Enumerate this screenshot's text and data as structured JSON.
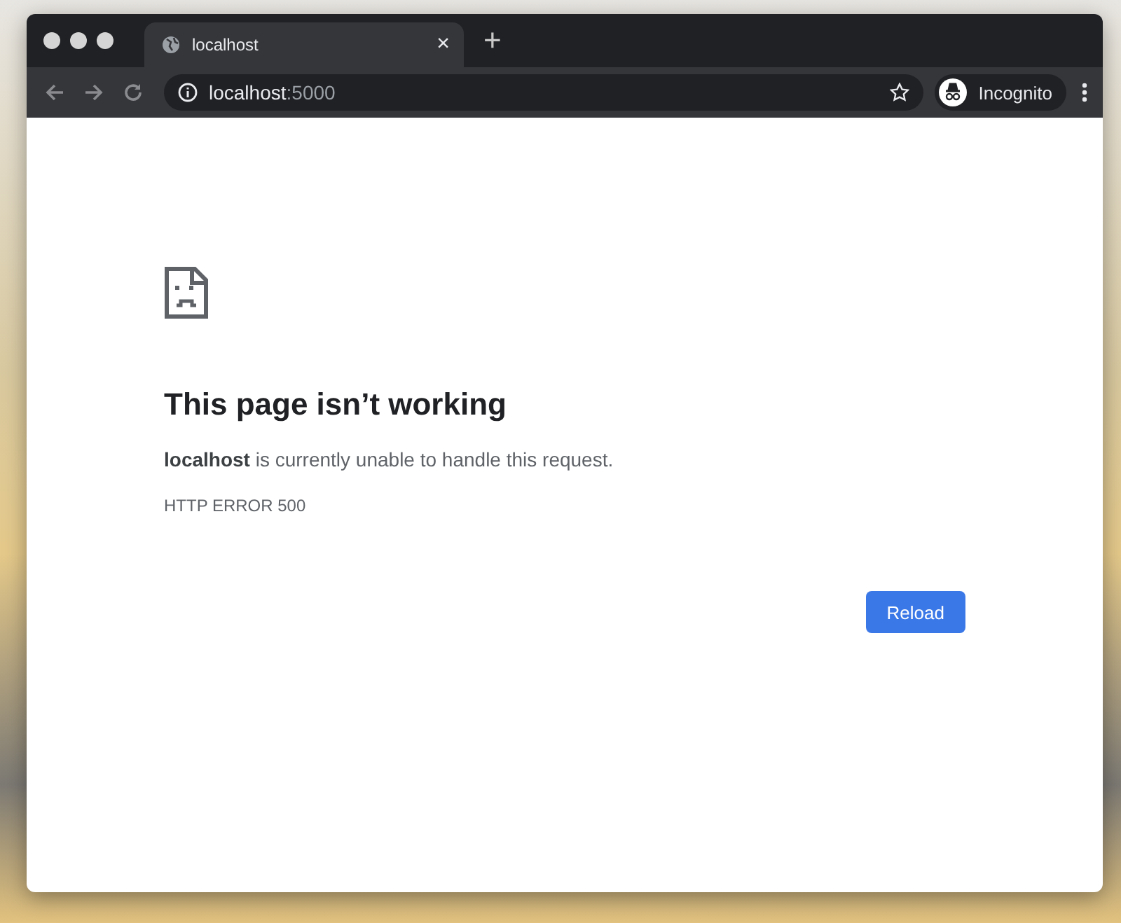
{
  "tabs": [
    {
      "title": "localhost",
      "close": "×",
      "selected": true
    }
  ],
  "new_tab": "+",
  "address_bar": {
    "host": "localhost",
    "port": ":5000"
  },
  "profile": {
    "label": "Incognito"
  },
  "error_page": {
    "heading": "This page isn’t working",
    "message": "**localhost** is currently unable to handle this request.",
    "error_code": "HTTP ERROR 500",
    "button": "Reload"
  }
}
